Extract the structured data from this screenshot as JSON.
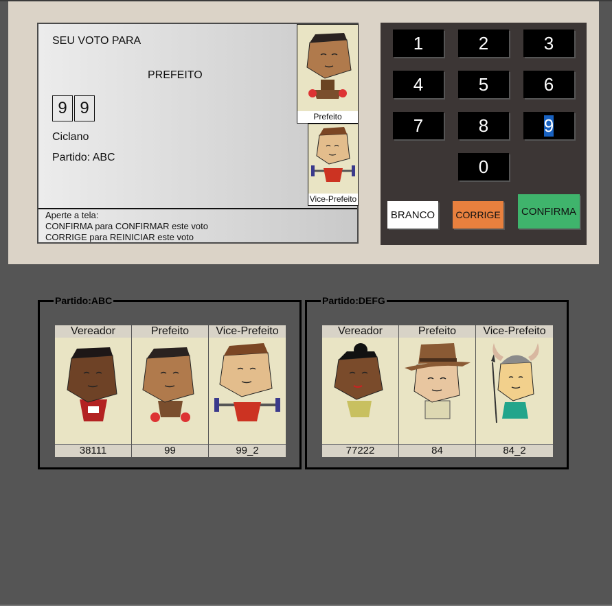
{
  "screen": {
    "voto_para": "SEU VOTO PARA",
    "cargo": "PREFEITO",
    "digits": [
      "9",
      "9"
    ],
    "candidate_name": "Ciclano",
    "party_line": "Partido: ABC",
    "photo_main_caption": "Prefeito",
    "photo_vice_caption": "Vice-Prefeito",
    "instructions": [
      "Aperte a tela:",
      "CONFIRMA para CONFIRMAR este voto",
      "CORRIGE para REINICIAR este voto"
    ]
  },
  "keypad": {
    "keys": [
      "1",
      "2",
      "3",
      "4",
      "5",
      "6",
      "7",
      "8",
      "9",
      "0"
    ],
    "selected_key": "9",
    "branco": "BRANCO",
    "corrige": "CORRIGE",
    "confirma": "CONFIRMA",
    "colors": {
      "branco": "#ffffff",
      "corrige": "#e8803e",
      "confirma": "#3fb46c"
    }
  },
  "parties": [
    {
      "legend": "Partido:ABC",
      "cards": [
        {
          "role": "Vereador",
          "number": "38111",
          "icon": "vereador-abc-avatar"
        },
        {
          "role": "Prefeito",
          "number": "99",
          "icon": "prefeito-abc-avatar"
        },
        {
          "role": "Vice-Prefeito",
          "number": "99_2",
          "icon": "vice-prefeito-abc-avatar"
        }
      ]
    },
    {
      "legend": "Partido:DEFG",
      "cards": [
        {
          "role": "Vereador",
          "number": "77222",
          "icon": "vereador-defg-avatar"
        },
        {
          "role": "Prefeito",
          "number": "84",
          "icon": "prefeito-defg-avatar"
        },
        {
          "role": "Vice-Prefeito",
          "number": "84_2",
          "icon": "vice-prefeito-defg-avatar"
        }
      ]
    }
  ]
}
